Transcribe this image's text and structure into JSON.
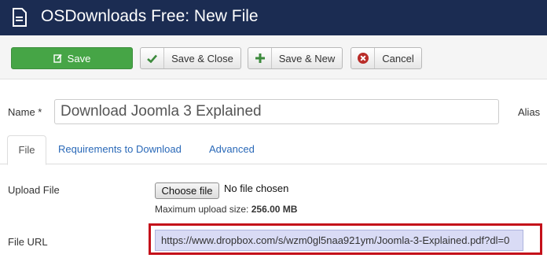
{
  "header": {
    "title": "OSDownloads Free: New File",
    "icon": "document-icon"
  },
  "toolbar": {
    "save_label": "Save",
    "save_icon": "edit-icon",
    "save_close_label": "Save & Close",
    "save_close_icon": "checkmark-icon",
    "save_new_label": "Save & New",
    "save_new_icon": "plus-icon",
    "cancel_label": "Cancel",
    "cancel_icon": "cancel-circle-icon"
  },
  "form": {
    "name_label": "Name *",
    "name_value": "Download Joomla 3 Explained",
    "alias_label": "Alias"
  },
  "tabs": [
    {
      "label": "File",
      "active": true
    },
    {
      "label": "Requirements to Download",
      "active": false
    },
    {
      "label": "Advanced",
      "active": false
    }
  ],
  "file_tab": {
    "upload_label": "Upload File",
    "choose_button": "Choose file",
    "no_file_text": "No file chosen",
    "max_size_prefix": "Maximum upload size:",
    "max_size_value": "256.00 MB",
    "url_label": "File URL",
    "url_value": "https://www.dropbox.com/s/wzm0gl5naa921ym/Joomla-3-Explained.pdf?dl=0"
  },
  "colors": {
    "header_bg": "#1b2c52",
    "save_green": "#46a546",
    "link_blue": "#2a69b8",
    "highlight_red": "#c4101a"
  }
}
